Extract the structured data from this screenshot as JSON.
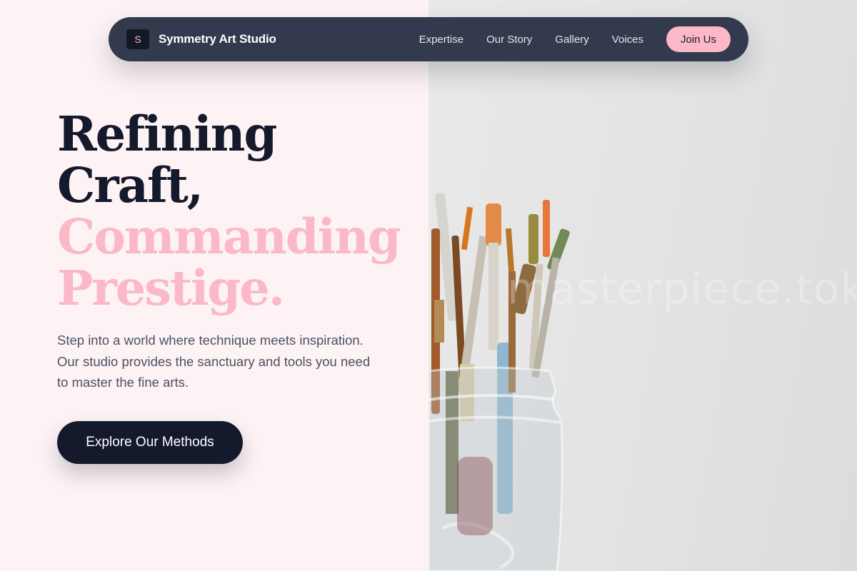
{
  "navbar": {
    "logo_letter": "S",
    "brand": "Symmetry Art Studio",
    "links": [
      "Expertise",
      "Our Story",
      "Gallery",
      "Voices"
    ],
    "cta": "Join Us"
  },
  "hero": {
    "heading_lines": [
      "Refining",
      "Craft,",
      "Commanding",
      "Prestige."
    ],
    "description": "Step into a world where technique meets inspiration. Our studio provides the sanctuary and tools you need to master the fine arts.",
    "button": "Explore Our Methods"
  },
  "image": {
    "subject": "paintbrushes-in-glass-jar",
    "watermark": "masterpiece.tokyo"
  },
  "colors": {
    "background": "#fdf3f5",
    "navbar": "#333a4d",
    "accent_pink": "#fbb8c6",
    "dark": "#141a2c"
  }
}
